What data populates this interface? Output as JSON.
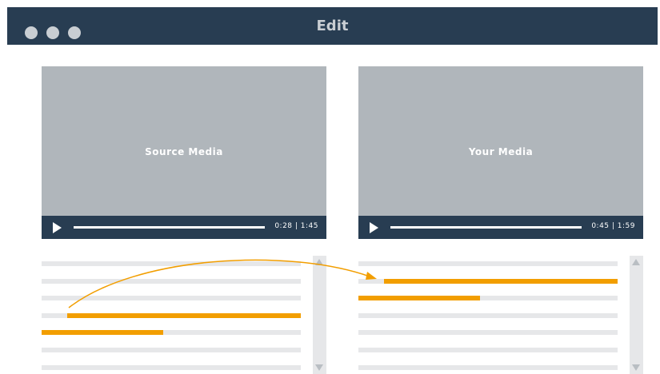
{
  "window": {
    "title": "Edit"
  },
  "source_player": {
    "label": "Source Media",
    "time": "0:28 | 1:45"
  },
  "your_player": {
    "label": "Your Media",
    "time": "0:45 | 1:59"
  },
  "colors": {
    "titlebar": "#283d52",
    "highlight": "#f29e00",
    "video_bg": "#b0b6bb",
    "line": "#e6e7e9"
  },
  "icons": [
    "window-dot",
    "play-icon",
    "scroll-up-arrow-icon",
    "scroll-down-arrow-icon",
    "drag-arrow-icon"
  ]
}
